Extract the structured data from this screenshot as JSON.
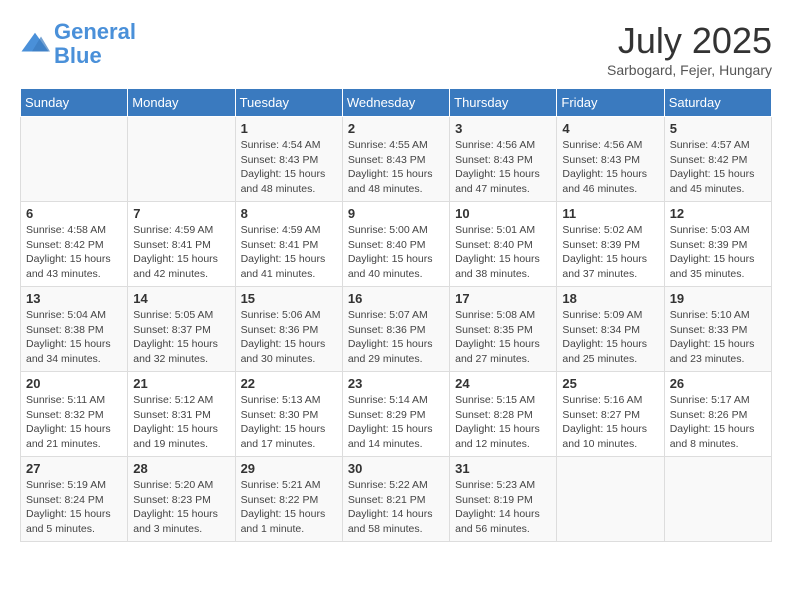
{
  "logo": {
    "line1": "General",
    "line2": "Blue"
  },
  "title": "July 2025",
  "subtitle": "Sarbogard, Fejer, Hungary",
  "weekdays": [
    "Sunday",
    "Monday",
    "Tuesday",
    "Wednesday",
    "Thursday",
    "Friday",
    "Saturday"
  ],
  "weeks": [
    [
      {
        "day": "",
        "sunrise": "",
        "sunset": "",
        "daylight": ""
      },
      {
        "day": "",
        "sunrise": "",
        "sunset": "",
        "daylight": ""
      },
      {
        "day": "1",
        "sunrise": "Sunrise: 4:54 AM",
        "sunset": "Sunset: 8:43 PM",
        "daylight": "Daylight: 15 hours and 48 minutes."
      },
      {
        "day": "2",
        "sunrise": "Sunrise: 4:55 AM",
        "sunset": "Sunset: 8:43 PM",
        "daylight": "Daylight: 15 hours and 48 minutes."
      },
      {
        "day": "3",
        "sunrise": "Sunrise: 4:56 AM",
        "sunset": "Sunset: 8:43 PM",
        "daylight": "Daylight: 15 hours and 47 minutes."
      },
      {
        "day": "4",
        "sunrise": "Sunrise: 4:56 AM",
        "sunset": "Sunset: 8:43 PM",
        "daylight": "Daylight: 15 hours and 46 minutes."
      },
      {
        "day": "5",
        "sunrise": "Sunrise: 4:57 AM",
        "sunset": "Sunset: 8:42 PM",
        "daylight": "Daylight: 15 hours and 45 minutes."
      }
    ],
    [
      {
        "day": "6",
        "sunrise": "Sunrise: 4:58 AM",
        "sunset": "Sunset: 8:42 PM",
        "daylight": "Daylight: 15 hours and 43 minutes."
      },
      {
        "day": "7",
        "sunrise": "Sunrise: 4:59 AM",
        "sunset": "Sunset: 8:41 PM",
        "daylight": "Daylight: 15 hours and 42 minutes."
      },
      {
        "day": "8",
        "sunrise": "Sunrise: 4:59 AM",
        "sunset": "Sunset: 8:41 PM",
        "daylight": "Daylight: 15 hours and 41 minutes."
      },
      {
        "day": "9",
        "sunrise": "Sunrise: 5:00 AM",
        "sunset": "Sunset: 8:40 PM",
        "daylight": "Daylight: 15 hours and 40 minutes."
      },
      {
        "day": "10",
        "sunrise": "Sunrise: 5:01 AM",
        "sunset": "Sunset: 8:40 PM",
        "daylight": "Daylight: 15 hours and 38 minutes."
      },
      {
        "day": "11",
        "sunrise": "Sunrise: 5:02 AM",
        "sunset": "Sunset: 8:39 PM",
        "daylight": "Daylight: 15 hours and 37 minutes."
      },
      {
        "day": "12",
        "sunrise": "Sunrise: 5:03 AM",
        "sunset": "Sunset: 8:39 PM",
        "daylight": "Daylight: 15 hours and 35 minutes."
      }
    ],
    [
      {
        "day": "13",
        "sunrise": "Sunrise: 5:04 AM",
        "sunset": "Sunset: 8:38 PM",
        "daylight": "Daylight: 15 hours and 34 minutes."
      },
      {
        "day": "14",
        "sunrise": "Sunrise: 5:05 AM",
        "sunset": "Sunset: 8:37 PM",
        "daylight": "Daylight: 15 hours and 32 minutes."
      },
      {
        "day": "15",
        "sunrise": "Sunrise: 5:06 AM",
        "sunset": "Sunset: 8:36 PM",
        "daylight": "Daylight: 15 hours and 30 minutes."
      },
      {
        "day": "16",
        "sunrise": "Sunrise: 5:07 AM",
        "sunset": "Sunset: 8:36 PM",
        "daylight": "Daylight: 15 hours and 29 minutes."
      },
      {
        "day": "17",
        "sunrise": "Sunrise: 5:08 AM",
        "sunset": "Sunset: 8:35 PM",
        "daylight": "Daylight: 15 hours and 27 minutes."
      },
      {
        "day": "18",
        "sunrise": "Sunrise: 5:09 AM",
        "sunset": "Sunset: 8:34 PM",
        "daylight": "Daylight: 15 hours and 25 minutes."
      },
      {
        "day": "19",
        "sunrise": "Sunrise: 5:10 AM",
        "sunset": "Sunset: 8:33 PM",
        "daylight": "Daylight: 15 hours and 23 minutes."
      }
    ],
    [
      {
        "day": "20",
        "sunrise": "Sunrise: 5:11 AM",
        "sunset": "Sunset: 8:32 PM",
        "daylight": "Daylight: 15 hours and 21 minutes."
      },
      {
        "day": "21",
        "sunrise": "Sunrise: 5:12 AM",
        "sunset": "Sunset: 8:31 PM",
        "daylight": "Daylight: 15 hours and 19 minutes."
      },
      {
        "day": "22",
        "sunrise": "Sunrise: 5:13 AM",
        "sunset": "Sunset: 8:30 PM",
        "daylight": "Daylight: 15 hours and 17 minutes."
      },
      {
        "day": "23",
        "sunrise": "Sunrise: 5:14 AM",
        "sunset": "Sunset: 8:29 PM",
        "daylight": "Daylight: 15 hours and 14 minutes."
      },
      {
        "day": "24",
        "sunrise": "Sunrise: 5:15 AM",
        "sunset": "Sunset: 8:28 PM",
        "daylight": "Daylight: 15 hours and 12 minutes."
      },
      {
        "day": "25",
        "sunrise": "Sunrise: 5:16 AM",
        "sunset": "Sunset: 8:27 PM",
        "daylight": "Daylight: 15 hours and 10 minutes."
      },
      {
        "day": "26",
        "sunrise": "Sunrise: 5:17 AM",
        "sunset": "Sunset: 8:26 PM",
        "daylight": "Daylight: 15 hours and 8 minutes."
      }
    ],
    [
      {
        "day": "27",
        "sunrise": "Sunrise: 5:19 AM",
        "sunset": "Sunset: 8:24 PM",
        "daylight": "Daylight: 15 hours and 5 minutes."
      },
      {
        "day": "28",
        "sunrise": "Sunrise: 5:20 AM",
        "sunset": "Sunset: 8:23 PM",
        "daylight": "Daylight: 15 hours and 3 minutes."
      },
      {
        "day": "29",
        "sunrise": "Sunrise: 5:21 AM",
        "sunset": "Sunset: 8:22 PM",
        "daylight": "Daylight: 15 hours and 1 minute."
      },
      {
        "day": "30",
        "sunrise": "Sunrise: 5:22 AM",
        "sunset": "Sunset: 8:21 PM",
        "daylight": "Daylight: 14 hours and 58 minutes."
      },
      {
        "day": "31",
        "sunrise": "Sunrise: 5:23 AM",
        "sunset": "Sunset: 8:19 PM",
        "daylight": "Daylight: 14 hours and 56 minutes."
      },
      {
        "day": "",
        "sunrise": "",
        "sunset": "",
        "daylight": ""
      },
      {
        "day": "",
        "sunrise": "",
        "sunset": "",
        "daylight": ""
      }
    ]
  ]
}
